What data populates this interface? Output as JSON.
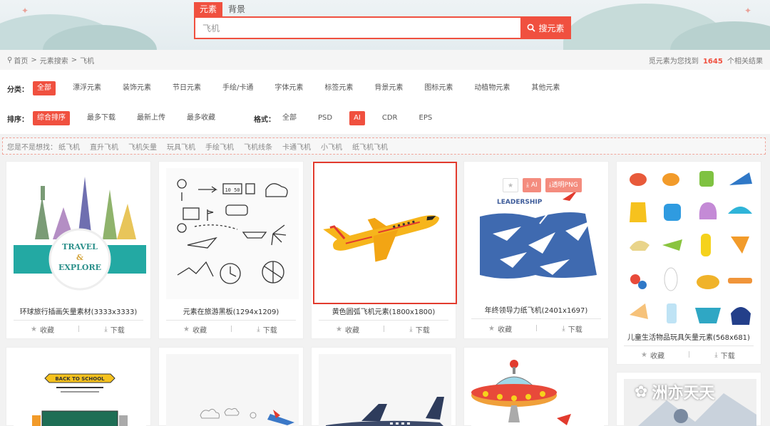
{
  "search": {
    "tabs": [
      "元素",
      "背景"
    ],
    "query": "飞机",
    "button_label": "搜元素"
  },
  "breadcrumb": {
    "home": "首页",
    "section": "元素搜索",
    "current": "飞机",
    "result_prefix": "觅元素为您找到",
    "result_count": "1645",
    "result_suffix": "个相关结果"
  },
  "filters": {
    "category_label": "分类：",
    "categories": [
      "全部",
      "漂浮元素",
      "装饰元素",
      "节日元素",
      "手绘/卡通",
      "字体元素",
      "标签元素",
      "背景元素",
      "图标元素",
      "动植物元素",
      "其他元素"
    ],
    "sort_label": "排序：",
    "sorts": [
      "综合排序",
      "最多下载",
      "最新上传",
      "最多收藏"
    ],
    "format_label": "格式：",
    "formats": [
      "全部",
      "PSD",
      "AI",
      "CDR",
      "EPS"
    ]
  },
  "suggest": {
    "label": "您是不是想找：",
    "items": [
      "纸飞机",
      "直升飞机",
      "飞机矢量",
      "玩具飞机",
      "手绘飞机",
      "飞机线条",
      "卡通飞机",
      "小飞机",
      "纸飞机飞机"
    ]
  },
  "cards": [
    {
      "title": "环球旅行插画矢量素材(3333x3333)",
      "fav": "收藏",
      "download": "下载"
    },
    {
      "title": "元素在旅游黑板(1294x1209)",
      "fav": "收藏",
      "download": "下载"
    },
    {
      "title": "黄色圆弧飞机元素(1800x1800)",
      "fav": "收藏",
      "download": "下载"
    },
    {
      "title": "年终领导力纸飞机(2401x1697)",
      "fav": "收藏",
      "download": "下载"
    },
    {
      "title": "儿童生活物品玩具矢量元素(568x681)",
      "fav": "收藏",
      "download": "下载"
    }
  ],
  "card4_badges": {
    "ai": "AI",
    "png": "透明PNG"
  },
  "thumb_text": {
    "travel": "TRAVEL",
    "amp": "&",
    "explore": "EXPLORE",
    "leadership": "LEADERSHIP",
    "school": "BACK TO SCHOOL",
    "sign": "10 50"
  },
  "watermark": "洲亦天天",
  "colors": {
    "accent": "#f0503f"
  }
}
